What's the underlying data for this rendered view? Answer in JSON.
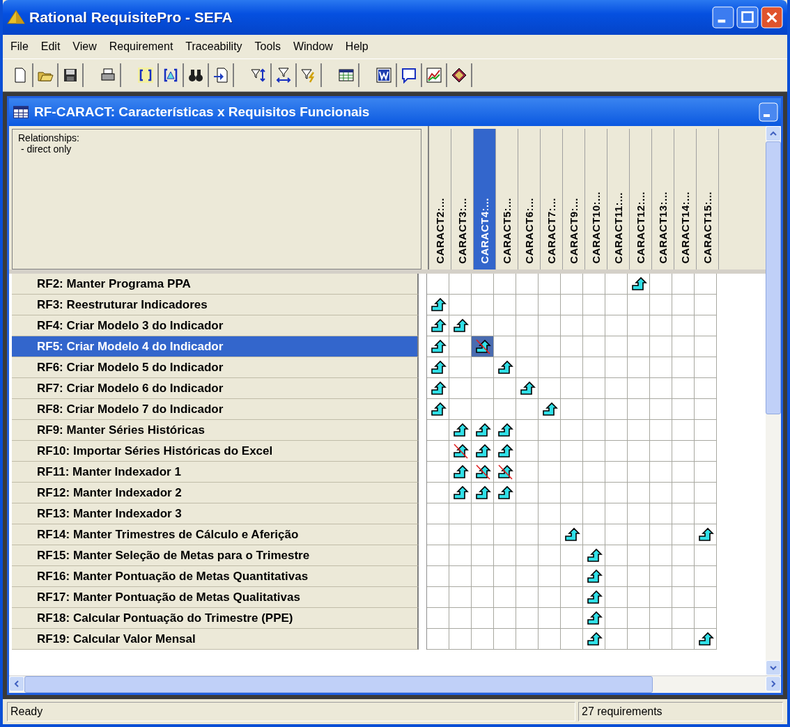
{
  "window": {
    "title": "Rational RequisitePro - SEFA"
  },
  "menu": [
    "File",
    "Edit",
    "View",
    "Requirement",
    "Traceability",
    "Tools",
    "Window",
    "Help"
  ],
  "child_window": {
    "title": "RF-CARACT: Características x Requisitos Funcionais"
  },
  "relationships_label": "Relationships:",
  "relationships_filter": " - direct only",
  "columns": [
    {
      "label": "CARACT2:...",
      "selected": false
    },
    {
      "label": "CARACT3:...",
      "selected": false
    },
    {
      "label": "CARACT4:...",
      "selected": true
    },
    {
      "label": "CARACT5:...",
      "selected": false
    },
    {
      "label": "CARACT6:...",
      "selected": false
    },
    {
      "label": "CARACT7:...",
      "selected": false
    },
    {
      "label": "CARACT9:...",
      "selected": false
    },
    {
      "label": "CARACT10:...",
      "selected": false
    },
    {
      "label": "CARACT11:...",
      "selected": false
    },
    {
      "label": "CARACT12:...",
      "selected": false
    },
    {
      "label": "CARACT13:...",
      "selected": false
    },
    {
      "label": "CARACT14:...",
      "selected": false
    },
    {
      "label": "CARACT15:...",
      "selected": false
    }
  ],
  "rows": [
    {
      "label": "RF2: Manter Programa PPA",
      "selected": false,
      "cells": [
        {
          "kind": "empty"
        },
        {
          "kind": "empty"
        },
        {
          "kind": "empty"
        },
        {
          "kind": "empty"
        },
        {
          "kind": "empty"
        },
        {
          "kind": "empty"
        },
        {
          "kind": "empty"
        },
        {
          "kind": "empty"
        },
        {
          "kind": "empty"
        },
        {
          "kind": "trace"
        },
        {
          "kind": "empty"
        },
        {
          "kind": "empty"
        },
        {
          "kind": "empty"
        }
      ]
    },
    {
      "label": "RF3: Reestruturar Indicadores",
      "selected": false,
      "cells": [
        {
          "kind": "trace"
        },
        {
          "kind": "empty"
        },
        {
          "kind": "empty"
        },
        {
          "kind": "empty"
        },
        {
          "kind": "empty"
        },
        {
          "kind": "empty"
        },
        {
          "kind": "empty"
        },
        {
          "kind": "empty"
        },
        {
          "kind": "empty"
        },
        {
          "kind": "empty"
        },
        {
          "kind": "empty"
        },
        {
          "kind": "empty"
        },
        {
          "kind": "empty"
        }
      ]
    },
    {
      "label": "RF4: Criar Modelo 3 do Indicador",
      "selected": false,
      "cells": [
        {
          "kind": "trace"
        },
        {
          "kind": "trace"
        },
        {
          "kind": "empty"
        },
        {
          "kind": "empty"
        },
        {
          "kind": "empty"
        },
        {
          "kind": "empty"
        },
        {
          "kind": "empty"
        },
        {
          "kind": "empty"
        },
        {
          "kind": "empty"
        },
        {
          "kind": "empty"
        },
        {
          "kind": "empty"
        },
        {
          "kind": "empty"
        },
        {
          "kind": "empty"
        }
      ]
    },
    {
      "label": "RF5: Criar Modelo 4 do Indicador",
      "selected": true,
      "cells": [
        {
          "kind": "trace"
        },
        {
          "kind": "empty"
        },
        {
          "kind": "suspect"
        },
        {
          "kind": "empty"
        },
        {
          "kind": "empty"
        },
        {
          "kind": "empty"
        },
        {
          "kind": "empty"
        },
        {
          "kind": "empty"
        },
        {
          "kind": "empty"
        },
        {
          "kind": "empty"
        },
        {
          "kind": "empty"
        },
        {
          "kind": "empty"
        },
        {
          "kind": "empty"
        }
      ]
    },
    {
      "label": "RF6: Criar Modelo 5 do Indicador",
      "selected": false,
      "cells": [
        {
          "kind": "trace"
        },
        {
          "kind": "empty"
        },
        {
          "kind": "empty"
        },
        {
          "kind": "trace"
        },
        {
          "kind": "empty"
        },
        {
          "kind": "empty"
        },
        {
          "kind": "empty"
        },
        {
          "kind": "empty"
        },
        {
          "kind": "empty"
        },
        {
          "kind": "empty"
        },
        {
          "kind": "empty"
        },
        {
          "kind": "empty"
        },
        {
          "kind": "empty"
        }
      ]
    },
    {
      "label": "RF7: Criar Modelo 6 do Indicador",
      "selected": false,
      "cells": [
        {
          "kind": "trace"
        },
        {
          "kind": "empty"
        },
        {
          "kind": "empty"
        },
        {
          "kind": "empty"
        },
        {
          "kind": "trace"
        },
        {
          "kind": "empty"
        },
        {
          "kind": "empty"
        },
        {
          "kind": "empty"
        },
        {
          "kind": "empty"
        },
        {
          "kind": "empty"
        },
        {
          "kind": "empty"
        },
        {
          "kind": "empty"
        },
        {
          "kind": "empty"
        }
      ]
    },
    {
      "label": "RF8: Criar Modelo 7 do Indicador",
      "selected": false,
      "cells": [
        {
          "kind": "trace"
        },
        {
          "kind": "empty"
        },
        {
          "kind": "empty"
        },
        {
          "kind": "empty"
        },
        {
          "kind": "empty"
        },
        {
          "kind": "trace"
        },
        {
          "kind": "empty"
        },
        {
          "kind": "empty"
        },
        {
          "kind": "empty"
        },
        {
          "kind": "empty"
        },
        {
          "kind": "empty"
        },
        {
          "kind": "empty"
        },
        {
          "kind": "empty"
        }
      ]
    },
    {
      "label": "RF9: Manter Séries Históricas",
      "selected": false,
      "cells": [
        {
          "kind": "empty"
        },
        {
          "kind": "trace"
        },
        {
          "kind": "trace"
        },
        {
          "kind": "trace"
        },
        {
          "kind": "empty"
        },
        {
          "kind": "empty"
        },
        {
          "kind": "empty"
        },
        {
          "kind": "empty"
        },
        {
          "kind": "empty"
        },
        {
          "kind": "empty"
        },
        {
          "kind": "empty"
        },
        {
          "kind": "empty"
        },
        {
          "kind": "empty"
        }
      ]
    },
    {
      "label": "RF10: Importar Séries Históricas do Excel",
      "selected": false,
      "cells": [
        {
          "kind": "empty"
        },
        {
          "kind": "suspect"
        },
        {
          "kind": "trace"
        },
        {
          "kind": "trace"
        },
        {
          "kind": "empty"
        },
        {
          "kind": "empty"
        },
        {
          "kind": "empty"
        },
        {
          "kind": "empty"
        },
        {
          "kind": "empty"
        },
        {
          "kind": "empty"
        },
        {
          "kind": "empty"
        },
        {
          "kind": "empty"
        },
        {
          "kind": "empty"
        }
      ]
    },
    {
      "label": "RF11: Manter Indexador 1",
      "selected": false,
      "cells": [
        {
          "kind": "empty"
        },
        {
          "kind": "trace"
        },
        {
          "kind": "suspect"
        },
        {
          "kind": "suspect"
        },
        {
          "kind": "empty"
        },
        {
          "kind": "empty"
        },
        {
          "kind": "empty"
        },
        {
          "kind": "empty"
        },
        {
          "kind": "empty"
        },
        {
          "kind": "empty"
        },
        {
          "kind": "empty"
        },
        {
          "kind": "empty"
        },
        {
          "kind": "empty"
        }
      ]
    },
    {
      "label": "RF12: Manter Indexador 2",
      "selected": false,
      "cells": [
        {
          "kind": "empty"
        },
        {
          "kind": "trace"
        },
        {
          "kind": "trace"
        },
        {
          "kind": "trace"
        },
        {
          "kind": "empty"
        },
        {
          "kind": "empty"
        },
        {
          "kind": "empty"
        },
        {
          "kind": "empty"
        },
        {
          "kind": "empty"
        },
        {
          "kind": "empty"
        },
        {
          "kind": "empty"
        },
        {
          "kind": "empty"
        },
        {
          "kind": "empty"
        }
      ]
    },
    {
      "label": "RF13: Manter Indexador 3",
      "selected": false,
      "cells": [
        {
          "kind": "empty"
        },
        {
          "kind": "empty"
        },
        {
          "kind": "empty"
        },
        {
          "kind": "empty"
        },
        {
          "kind": "empty"
        },
        {
          "kind": "empty"
        },
        {
          "kind": "empty"
        },
        {
          "kind": "empty"
        },
        {
          "kind": "empty"
        },
        {
          "kind": "empty"
        },
        {
          "kind": "empty"
        },
        {
          "kind": "empty"
        },
        {
          "kind": "empty"
        }
      ]
    },
    {
      "label": "RF14: Manter Trimestres de Cálculo e Aferição",
      "selected": false,
      "cells": [
        {
          "kind": "empty"
        },
        {
          "kind": "empty"
        },
        {
          "kind": "empty"
        },
        {
          "kind": "empty"
        },
        {
          "kind": "empty"
        },
        {
          "kind": "empty"
        },
        {
          "kind": "trace"
        },
        {
          "kind": "empty"
        },
        {
          "kind": "empty"
        },
        {
          "kind": "empty"
        },
        {
          "kind": "empty"
        },
        {
          "kind": "empty"
        },
        {
          "kind": "trace"
        }
      ]
    },
    {
      "label": "RF15: Manter Seleção de Metas para o Trimestre",
      "selected": false,
      "cells": [
        {
          "kind": "empty"
        },
        {
          "kind": "empty"
        },
        {
          "kind": "empty"
        },
        {
          "kind": "empty"
        },
        {
          "kind": "empty"
        },
        {
          "kind": "empty"
        },
        {
          "kind": "empty"
        },
        {
          "kind": "trace"
        },
        {
          "kind": "empty"
        },
        {
          "kind": "empty"
        },
        {
          "kind": "empty"
        },
        {
          "kind": "empty"
        },
        {
          "kind": "empty"
        }
      ]
    },
    {
      "label": "RF16: Manter Pontuação de Metas Quantitativas",
      "selected": false,
      "cells": [
        {
          "kind": "empty"
        },
        {
          "kind": "empty"
        },
        {
          "kind": "empty"
        },
        {
          "kind": "empty"
        },
        {
          "kind": "empty"
        },
        {
          "kind": "empty"
        },
        {
          "kind": "empty"
        },
        {
          "kind": "trace"
        },
        {
          "kind": "empty"
        },
        {
          "kind": "empty"
        },
        {
          "kind": "empty"
        },
        {
          "kind": "empty"
        },
        {
          "kind": "empty"
        }
      ]
    },
    {
      "label": "RF17: Manter Pontuação de Metas Qualitativas",
      "selected": false,
      "cells": [
        {
          "kind": "empty"
        },
        {
          "kind": "empty"
        },
        {
          "kind": "empty"
        },
        {
          "kind": "empty"
        },
        {
          "kind": "empty"
        },
        {
          "kind": "empty"
        },
        {
          "kind": "empty"
        },
        {
          "kind": "trace"
        },
        {
          "kind": "empty"
        },
        {
          "kind": "empty"
        },
        {
          "kind": "empty"
        },
        {
          "kind": "empty"
        },
        {
          "kind": "empty"
        }
      ]
    },
    {
      "label": "RF18: Calcular Pontuação do Trimestre (PPE)",
      "selected": false,
      "cells": [
        {
          "kind": "empty"
        },
        {
          "kind": "empty"
        },
        {
          "kind": "empty"
        },
        {
          "kind": "empty"
        },
        {
          "kind": "empty"
        },
        {
          "kind": "empty"
        },
        {
          "kind": "empty"
        },
        {
          "kind": "trace"
        },
        {
          "kind": "empty"
        },
        {
          "kind": "empty"
        },
        {
          "kind": "empty"
        },
        {
          "kind": "empty"
        },
        {
          "kind": "empty"
        }
      ]
    },
    {
      "label": "RF19: Calcular Valor Mensal",
      "selected": false,
      "cells": [
        {
          "kind": "empty"
        },
        {
          "kind": "empty"
        },
        {
          "kind": "empty"
        },
        {
          "kind": "empty"
        },
        {
          "kind": "empty"
        },
        {
          "kind": "empty"
        },
        {
          "kind": "empty"
        },
        {
          "kind": "trace"
        },
        {
          "kind": "empty"
        },
        {
          "kind": "empty"
        },
        {
          "kind": "empty"
        },
        {
          "kind": "empty"
        },
        {
          "kind": "trace"
        }
      ]
    }
  ],
  "status_bar": {
    "message": "Ready",
    "count": "27 requirements"
  }
}
